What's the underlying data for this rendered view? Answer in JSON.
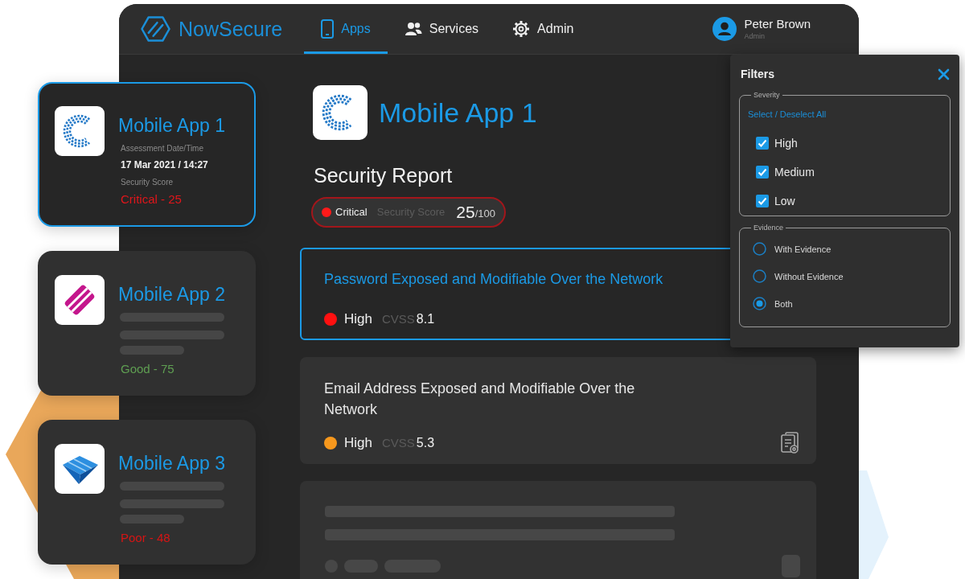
{
  "nav": {
    "brand": "NowSecure",
    "tabs": [
      {
        "label": "Apps",
        "selected": true
      },
      {
        "label": "Services",
        "selected": false
      },
      {
        "label": "Admin",
        "selected": false
      }
    ],
    "user": {
      "name": "Peter Brown",
      "role": "Admin"
    }
  },
  "apps": [
    {
      "kind": "details",
      "name": "Mobile App 1",
      "selected": true,
      "date_label": "Assessment Date/Time",
      "date": "17 Mar 2021 / 14:27",
      "score_label": "Security Score",
      "score": "Critical - 25",
      "color": "#e0161b"
    },
    {
      "kind": "loading",
      "name": "Mobile App 2",
      "selected": false,
      "score": "Good - 75",
      "color": "#5f9f52"
    },
    {
      "kind": "loading",
      "name": "Mobile App 3",
      "selected": false,
      "score": "Poor - 48",
      "color": "#d81414"
    }
  ],
  "report": {
    "title": "Mobile App 1",
    "subtitle": "Security Report",
    "rating": "Critical",
    "color": "#ff1a1a",
    "score_label": "Security Score",
    "score": "25",
    "score_max": "/100"
  },
  "findings": [
    {
      "kind": "finding",
      "title": "Password Exposed and Modifiable Over the Network",
      "selected": true,
      "severity": "High",
      "color": "#ff1010",
      "cvss_label": "CVSS",
      "cvss": "8.1"
    },
    {
      "kind": "finding",
      "title": "Email Address Exposed and Modifiable Over the Network",
      "selected": false,
      "severity": "High",
      "color": "#f7981d",
      "cvss_label": "CVSS",
      "cvss": "5.3",
      "report_icon": true
    },
    {
      "kind": "loading",
      "selected": false
    }
  ],
  "filters": {
    "title": "Filters",
    "groups": [
      {
        "kind": "checkbox",
        "legend": "Severity",
        "link": "Select / Deselect All",
        "options": [
          {
            "label": "High",
            "checked": true
          },
          {
            "label": "Medium",
            "checked": true
          },
          {
            "label": "Low",
            "checked": true
          }
        ]
      },
      {
        "kind": "radio",
        "legend": "Evidence",
        "options": [
          {
            "label": "With Evidence",
            "selected": false
          },
          {
            "label": "Without Evidence",
            "selected": false
          },
          {
            "label": "Both",
            "selected": true
          }
        ]
      }
    ]
  }
}
